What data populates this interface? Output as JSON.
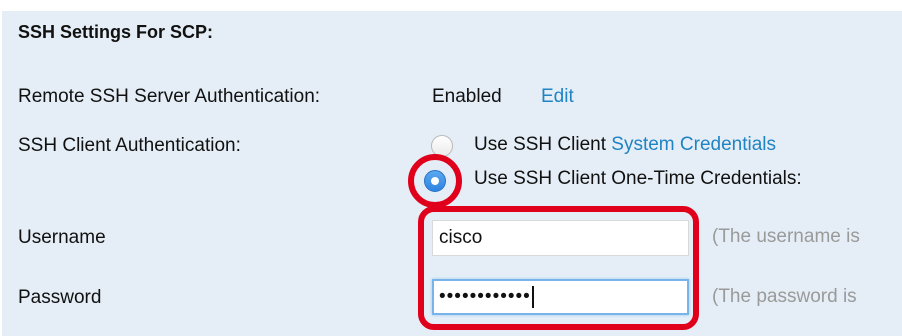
{
  "section": {
    "title": "SSH Settings For SCP:"
  },
  "remote_auth": {
    "label": "Remote SSH Server Authentication:",
    "value": "Enabled",
    "edit_link": "Edit"
  },
  "client_auth": {
    "label": "SSH Client Authentication:",
    "options": [
      {
        "prefix": "Use SSH Client ",
        "link": "System Credentials",
        "selected": false
      },
      {
        "prefix": "Use SSH Client One-Time Credentials:",
        "selected": true
      }
    ]
  },
  "username": {
    "label": "Username",
    "value": "cisco",
    "hint": "(The username is"
  },
  "password": {
    "label": "Password",
    "value": "••••••••••••",
    "hint": "(The password is"
  },
  "colors": {
    "panel_bg": "#e5eef6",
    "link": "#1f83c4",
    "highlight": "#e0001b",
    "radio_selected": "#2f84e1"
  }
}
